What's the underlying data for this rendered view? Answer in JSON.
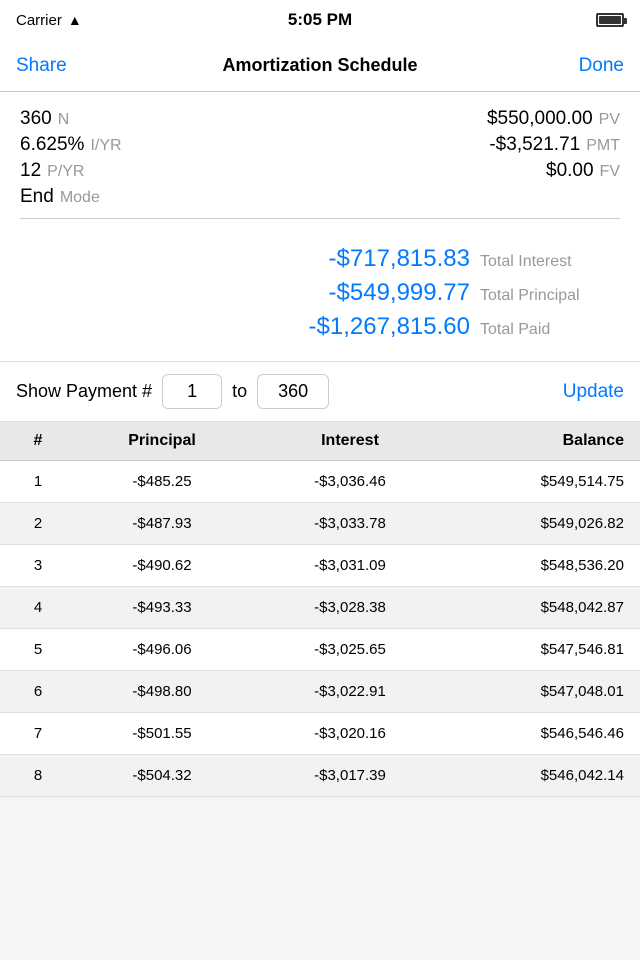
{
  "status": {
    "carrier": "Carrier",
    "time": "5:05 PM"
  },
  "nav": {
    "share_label": "Share",
    "title": "Amortization Schedule",
    "done_label": "Done"
  },
  "params": {
    "n_value": "360",
    "n_label": "N",
    "pv_value": "$550,000.00",
    "pv_label": "PV",
    "iyr_value": "6.625%",
    "iyr_label": "I/YR",
    "pmt_value": "-$3,521.71",
    "pmt_label": "PMT",
    "pyr_value": "12",
    "pyr_label": "P/YR",
    "fv_value": "$0.00",
    "fv_label": "FV",
    "mode_value": "End",
    "mode_label": "Mode"
  },
  "totals": {
    "total_interest_value": "-$717,815.83",
    "total_interest_label": "Total Interest",
    "total_principal_value": "-$549,999.77",
    "total_principal_label": "Total Principal",
    "total_paid_value": "-$1,267,815.60",
    "total_paid_label": "Total Paid"
  },
  "payment_range": {
    "label": "Show Payment #",
    "from_value": "1",
    "to_label": "to",
    "to_value": "360",
    "update_label": "Update"
  },
  "table": {
    "headers": [
      "#",
      "Principal",
      "Interest",
      "Balance"
    ],
    "rows": [
      {
        "num": "1",
        "principal": "-$485.25",
        "interest": "-$3,036.46",
        "balance": "$549,514.75"
      },
      {
        "num": "2",
        "principal": "-$487.93",
        "interest": "-$3,033.78",
        "balance": "$549,026.82"
      },
      {
        "num": "3",
        "principal": "-$490.62",
        "interest": "-$3,031.09",
        "balance": "$548,536.20"
      },
      {
        "num": "4",
        "principal": "-$493.33",
        "interest": "-$3,028.38",
        "balance": "$548,042.87"
      },
      {
        "num": "5",
        "principal": "-$496.06",
        "interest": "-$3,025.65",
        "balance": "$547,546.81"
      },
      {
        "num": "6",
        "principal": "-$498.80",
        "interest": "-$3,022.91",
        "balance": "$547,048.01"
      },
      {
        "num": "7",
        "principal": "-$501.55",
        "interest": "-$3,020.16",
        "balance": "$546,546.46"
      },
      {
        "num": "8",
        "principal": "-$504.32",
        "interest": "-$3,017.39",
        "balance": "$546,042.14"
      }
    ]
  }
}
